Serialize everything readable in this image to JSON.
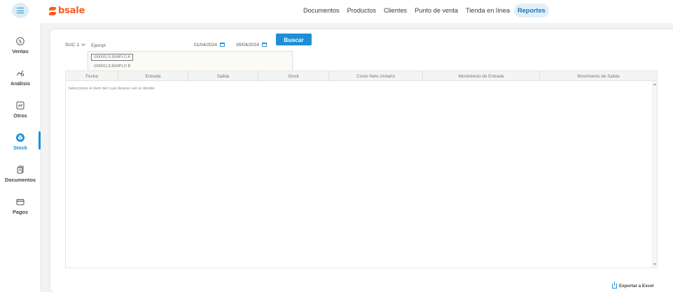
{
  "app": {
    "logo_text": "bsale",
    "brand_color": "#ff5a1f",
    "accent_color": "#1e8fd6"
  },
  "topnav": {
    "items": [
      {
        "label": "Documentos",
        "active": false
      },
      {
        "label": "Productos",
        "active": false
      },
      {
        "label": "Clientes",
        "active": false
      },
      {
        "label": "Punto de venta",
        "active": false
      },
      {
        "label": "Tienda en línea",
        "active": false
      },
      {
        "label": "Reportes",
        "active": true
      }
    ]
  },
  "sidebar": {
    "items": [
      {
        "label": "Ventas",
        "icon": "dollar-circle-icon",
        "active": false
      },
      {
        "label": "Análisis",
        "icon": "analytics-line-icon",
        "active": false
      },
      {
        "label": "Otros",
        "icon": "chart-box-icon",
        "active": false
      },
      {
        "label": "Stock",
        "icon": "cube-icon",
        "active": true
      },
      {
        "label": "Documentos",
        "icon": "documents-icon",
        "active": false
      },
      {
        "label": "Pagos",
        "icon": "credit-card-icon",
        "active": false
      }
    ]
  },
  "filters": {
    "branch": "SUC 1",
    "search_value": "Ejempl",
    "date_from": "01/04/2024",
    "date_to": "30/04/2024",
    "search_button": "Buscar"
  },
  "dropdown": {
    "options": [
      "(00000) EJEMPLO A",
      "(00001) EJEMPLO B"
    ]
  },
  "table": {
    "columns": [
      "Fecha",
      "Entrada",
      "Salida",
      "Stock",
      "Costo Neto Unitario",
      "Movimiento de Entrada",
      "Movimiento de Salida"
    ],
    "empty_message": "Selecciona el ítem del cual deseas ver el detalle"
  },
  "footer": {
    "export_label": "Exportar a Excel"
  }
}
